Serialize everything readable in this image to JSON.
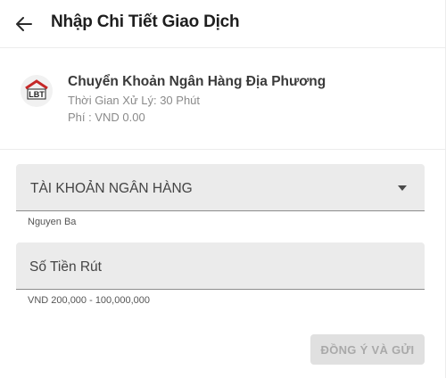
{
  "header": {
    "title": "Nhập Chi Tiết Giao Dịch",
    "back_icon": "arrow-left-icon"
  },
  "method": {
    "logo_text": "LBT",
    "name": "Chuyển Khoản Ngân Hàng Địa Phương",
    "processing_time": "Thời Gian Xử Lý: 30 Phút",
    "fee": "Phí : VND 0.00"
  },
  "bank_field": {
    "label": "TÀI KHOẢN NGÂN HÀNG",
    "helper": "Nguyen Ba",
    "icon": "dropdown-arrow-icon"
  },
  "amount_field": {
    "placeholder": "Số Tiền Rút",
    "helper": "VND 200,000 - 100,000,000"
  },
  "submit": {
    "label": "ĐỒNG Ý VÀ GỬI",
    "enabled": false
  },
  "colors": {
    "field_bg": "#ebebeb",
    "button_disabled_bg": "#e0e0e0",
    "button_disabled_text": "#a9a9a9",
    "logo_red": "#c62828"
  }
}
